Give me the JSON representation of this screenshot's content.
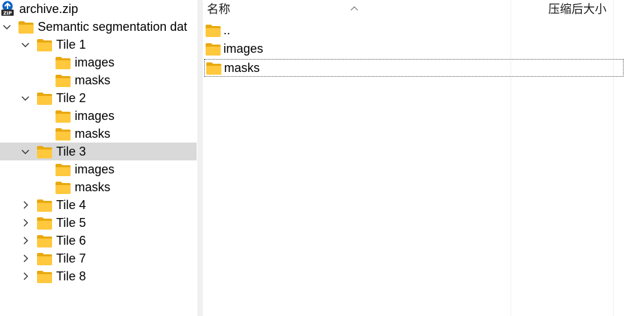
{
  "tree": {
    "root": {
      "label": "archive.zip",
      "icon": "zip-archive-icon"
    },
    "items": [
      {
        "label": "Semantic segmentation dat",
        "expanded": true
      },
      {
        "label": "Tile 1",
        "expanded": true
      },
      {
        "label": "images"
      },
      {
        "label": "masks"
      },
      {
        "label": "Tile 2",
        "expanded": true
      },
      {
        "label": "images"
      },
      {
        "label": "masks"
      },
      {
        "label": "Tile 3",
        "expanded": true,
        "selected": true
      },
      {
        "label": "images"
      },
      {
        "label": "masks"
      },
      {
        "label": "Tile 4",
        "expanded": false
      },
      {
        "label": "Tile 5",
        "expanded": false
      },
      {
        "label": "Tile 6",
        "expanded": false
      },
      {
        "label": "Tile 7",
        "expanded": false
      },
      {
        "label": "Tile 8",
        "expanded": false
      }
    ]
  },
  "list": {
    "columns": {
      "name": "名称",
      "compressed_size": "压缩后大小"
    },
    "rows": [
      {
        "label": ".."
      },
      {
        "label": "images"
      },
      {
        "label": "masks",
        "focused": true
      }
    ]
  },
  "colors": {
    "folder": "#ffc83d",
    "folder_dark": "#e8a90f",
    "selection": "#d9d9d9",
    "zip_blue": "#0b63c4"
  }
}
